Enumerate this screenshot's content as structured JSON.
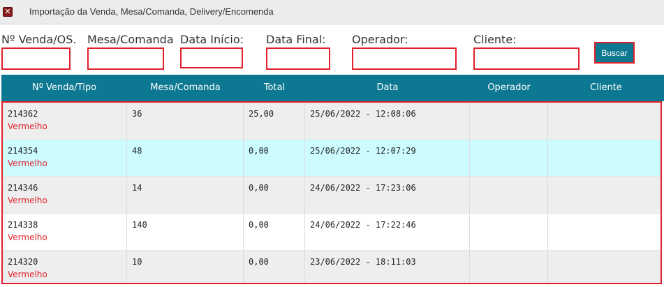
{
  "window": {
    "title": "Importação da Venda, Mesa/Comanda, Delivery/Encomenda",
    "close_glyph": "✕",
    "close_icon": "close-icon"
  },
  "filters": {
    "venda_label": "Nº Venda/OS.",
    "mesa_label": "Mesa/Comanda",
    "data_inicio_label": "Data Início:",
    "data_final_label": "Data Final:",
    "operador_label": "Operador:",
    "cliente_label": "Cliente:",
    "venda_value": "",
    "mesa_value": "",
    "data_inicio_value": "",
    "data_final_value": "",
    "operador_value": "",
    "cliente_value": "",
    "buscar_label": "Buscar"
  },
  "table": {
    "headers": [
      "Nº Venda/Tipo",
      "Mesa/Comanda",
      "Total",
      "Data",
      "Operador",
      "Cliente"
    ],
    "rows": [
      {
        "venda": "214362",
        "tipo": "Vermelho",
        "mesa": "36",
        "total": "25,00",
        "data": "25/06/2022 - 12:08:06",
        "operador": "",
        "cliente": "",
        "bg": "#eeeeee"
      },
      {
        "venda": "214354",
        "tipo": "Vermelho",
        "mesa": "48",
        "total": "0,00",
        "data": "25/06/2022 - 12:07:29",
        "operador": "",
        "cliente": "",
        "bg": "#ccfcfe"
      },
      {
        "venda": "214346",
        "tipo": "Vermelho",
        "mesa": "14",
        "total": "0,00",
        "data": "24/06/2022 - 17:23:06",
        "operador": "",
        "cliente": "",
        "bg": "#eeeeee"
      },
      {
        "venda": "214338",
        "tipo": "Vermelho",
        "mesa": "140",
        "total": "0,00",
        "data": "24/06/2022 - 17:22:46",
        "operador": "",
        "cliente": "",
        "bg": "#ffffff"
      },
      {
        "venda": "214320",
        "tipo": "Vermelho",
        "mesa": "10",
        "total": "0,00",
        "data": "23/06/2022 - 18:11:03",
        "operador": "",
        "cliente": "",
        "bg": "#eeeeee"
      }
    ]
  },
  "colors": {
    "header_bg": "#0d7891",
    "highlight_border": "#e0202a",
    "tipo_text": "#e0202a",
    "row_alt": "#eeeeee",
    "row_selected": "#ccfcfe"
  }
}
